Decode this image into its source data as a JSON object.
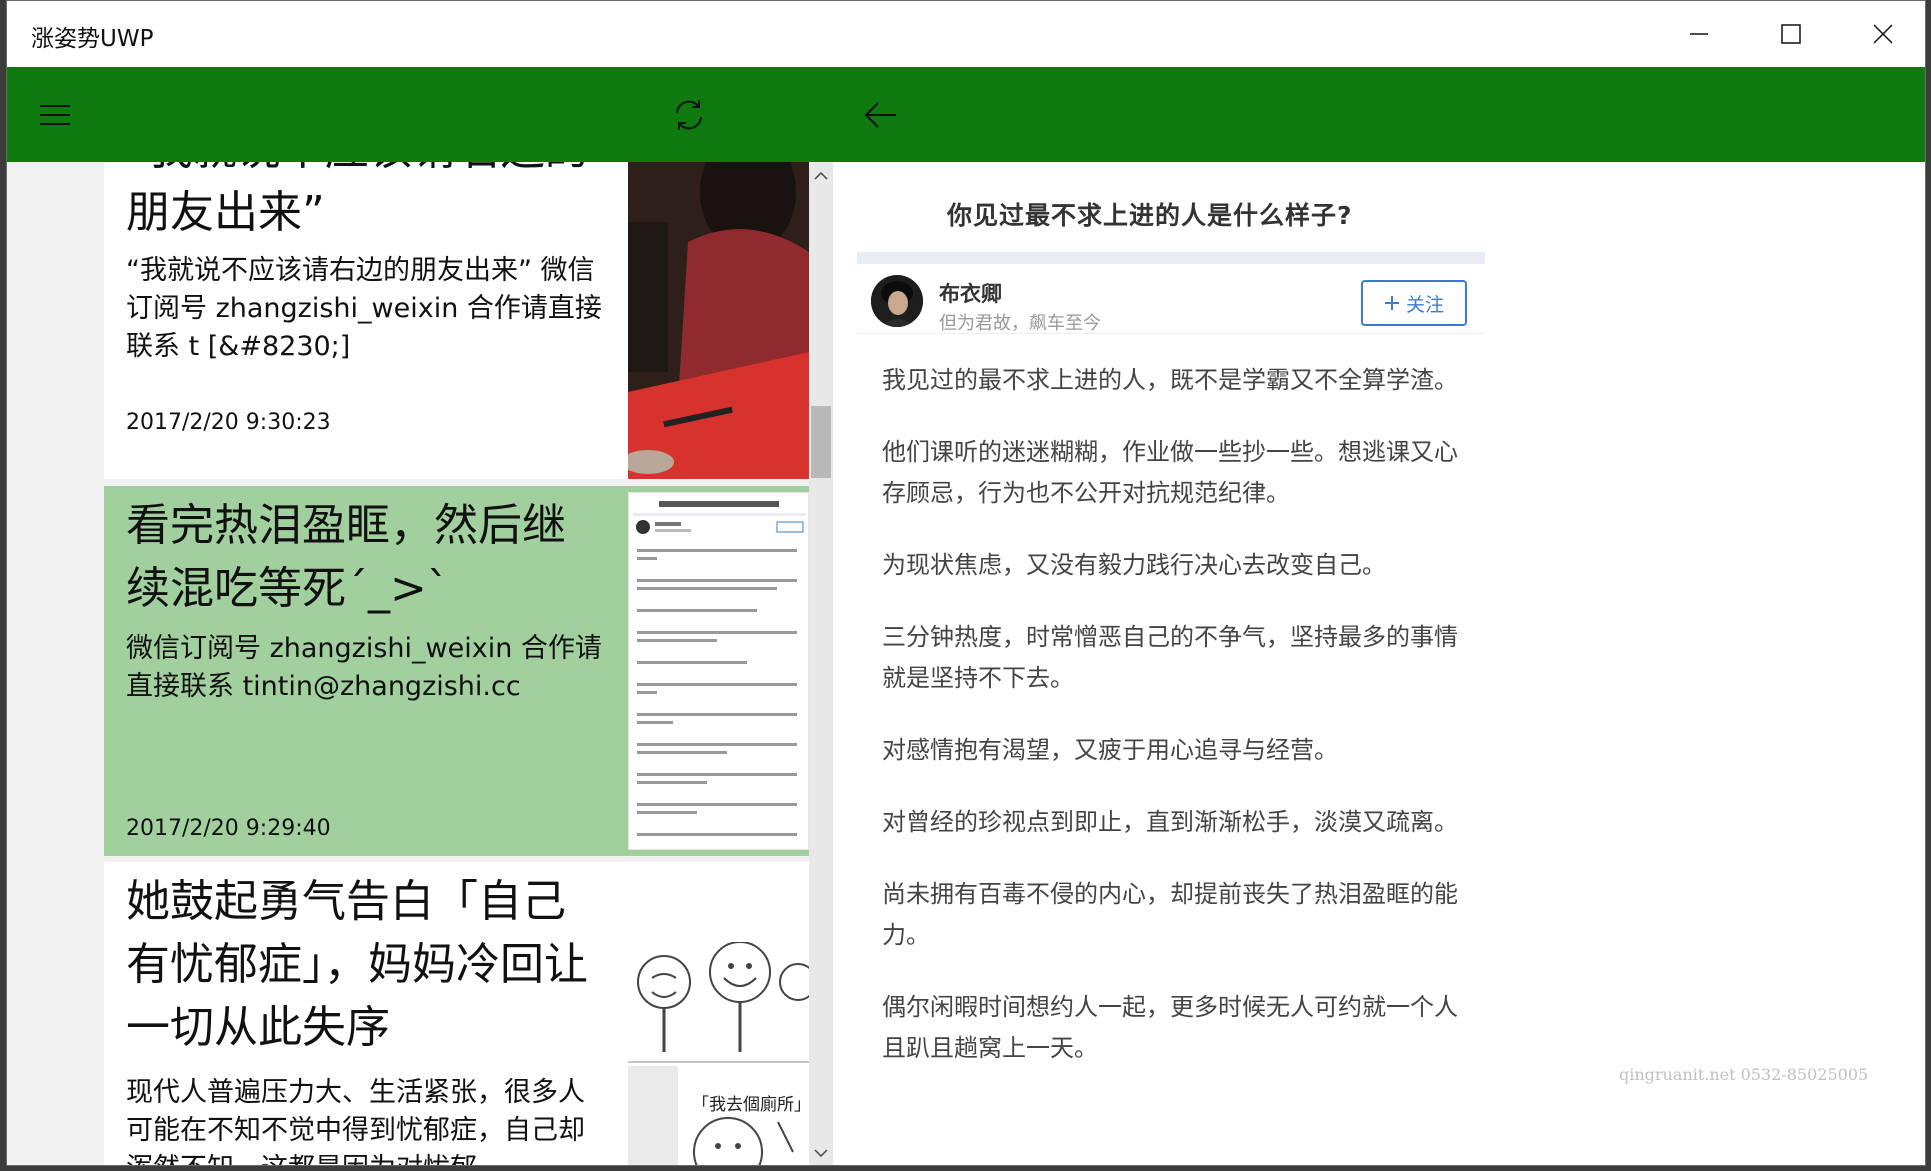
{
  "window": {
    "title": "涨姿势UWP"
  },
  "appbar": {
    "icons": [
      "hamburger-menu-icon",
      "refresh-icon",
      "back-arrow-icon"
    ]
  },
  "list": {
    "items": [
      {
        "title": "“我就说不应该请右边的朋友出来”",
        "desc": "“我就说不应该请右边的朋友出来” 微信订阅号 zhangzishi_weixin 合作请直接联系 t [&#8230;]",
        "date": "2017/2/20 9:30:23",
        "selected": false
      },
      {
        "title": "看完热泪盈眶，然后继续混吃等死´_>`",
        "desc": "微信订阅号 zhangzishi_weixin 合作请直接联系 tintin@zhangzishi.cc",
        "date": "2017/2/20 9:29:40",
        "selected": true
      },
      {
        "title": "她鼓起勇气告白「自己有忧郁症」，妈妈冷回让一切从此失序",
        "desc": "现代人普遍压力大、生活紧张，很多人可能在不知不觉中得到忧郁症，自己却浑然不知，这都是因为对忧郁",
        "date": "",
        "selected": false
      }
    ],
    "thumb_caption": "「我去個廁所」"
  },
  "article": {
    "title": "你见过最不求上进的人是什么样子?",
    "author_name": "布衣卿",
    "author_motto": "但为君故，飙车至今",
    "follow_label": "关注",
    "paragraphs": [
      "我见过的最不求上进的人，既不是学霸又不全算学渣。",
      "他们课听的迷迷糊糊，作业做一些抄一些。想逃课又心存顾忌，行为也不公开对抗规范纪律。",
      "为现状焦虑，又没有毅力践行决心去改变自己。",
      "三分钟热度，时常憎恶自己的不争气，坚持最多的事情就是坚持不下去。",
      "对感情抱有渴望，又疲于用心追寻与经营。",
      "对曾经的珍视点到即止，直到渐渐松手，淡漠又疏离。",
      "尚未拥有百毒不侵的内心，却提前丧失了热泪盈眶的能力。",
      "偶尔闲暇时间想约人一起，更多时候无人可约就一个人且趴且趟窝上一天。"
    ]
  },
  "watermark": "qingruanit.net 0532-85025005",
  "colors": {
    "appbar": "#0f7a0f",
    "selected": "#a2cf9e",
    "follow": "#3a7bd5"
  }
}
